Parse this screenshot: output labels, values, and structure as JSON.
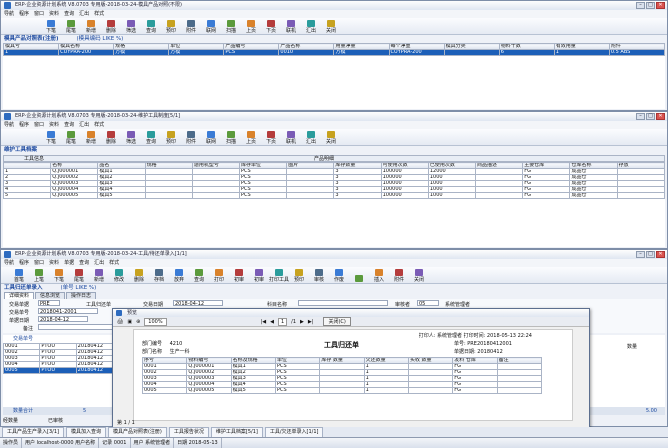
{
  "w1": {
    "title": "ERP-企业资源计划系统 V8.0703 专用版-2018-03-24-模具产品对照(不限)",
    "menus": [
      "导航",
      "程序",
      "窗口",
      "资料",
      "查询",
      "汇出",
      "样式"
    ],
    "tools": [
      "下笔",
      "尾笔",
      "新增",
      "删除",
      "筛选",
      "查询",
      "预印",
      "附件",
      "联网",
      "扫描",
      "上页",
      "下页",
      "联机",
      "汇出",
      "关闭"
    ],
    "sect": "模具产品对照表(注册)",
    "sect_sub": "(模具编码 LIKE %)",
    "cols": [
      "模具号",
      "模具名称",
      "规格",
      "单位",
      "产品编号",
      "产品名称",
      "用量净量",
      "每个净重",
      "模具分类",
      "物料十数",
      "有效用量",
      "附件"
    ],
    "row": [
      "1",
      "CUYPRA-200",
      "方模",
      "方模",
      "PCS",
      "0010",
      "方模",
      "CUYPRA-200",
      "",
      "6",
      "1",
      "0.5 ABS"
    ]
  },
  "w2": {
    "title": "ERP-企业资源计划系统 V8.0703 专用版-2018-03-24-维护工具制度[5/1]",
    "menus": [
      "导航",
      "程序",
      "窗口",
      "资料",
      "查询",
      "汇出",
      "样式"
    ],
    "tools": [
      "下笔",
      "尾笔",
      "新增",
      "删除",
      "筛选",
      "查询",
      "预印",
      "附件",
      "联网",
      "扫描",
      "上页",
      "下页",
      "联机",
      "汇出",
      "关闭"
    ],
    "sect": "维护工具档案",
    "group": "工具信息",
    "group2": "产品明细",
    "cols": [
      "",
      "名称",
      "品名",
      "规格",
      "适用机型号",
      "库存单位",
      "图片",
      "库存数量",
      "可使用次数",
      "已使用次数",
      "商品描述",
      "主要仓库",
      "仓库名称",
      "存放"
    ],
    "rows": [
      [
        "1",
        "Q.J000001",
        "模具1",
        "",
        "",
        "PCS",
        "",
        "3",
        "100000",
        "12000",
        "",
        "FG",
        "成品仓",
        ""
      ],
      [
        "2",
        "Q.J000002",
        "模具2",
        "",
        "",
        "PCS",
        "",
        "3",
        "100000",
        "1000",
        "",
        "FG",
        "成品仓",
        ""
      ],
      [
        "3",
        "Q.J000003",
        "模具3",
        "",
        "",
        "PCS",
        "",
        "3",
        "100000",
        "1000",
        "",
        "FG",
        "成品仓",
        ""
      ],
      [
        "4",
        "Q.J000004",
        "模具4",
        "",
        "",
        "PCS",
        "",
        "3",
        "100000",
        "1000",
        "",
        "FG",
        "成品仓",
        ""
      ],
      [
        "5",
        "Q.J000005",
        "模具5",
        "",
        "",
        "PCS",
        "",
        "3",
        "100000",
        "1000",
        "",
        "FG",
        "成品仓",
        ""
      ]
    ]
  },
  "w3": {
    "title": "ERP-企业资源计划系统 V8.0703 专用版-2018-03-24-工具/待还单录入[1/1]",
    "menus": [
      "导航",
      "程序",
      "窗口",
      "资料",
      "单据",
      "查询",
      "汇出",
      "样式"
    ],
    "tools": [
      "首笔",
      "上笔",
      "下笔",
      "尾笔",
      "新增",
      "修改",
      "删除",
      "存档",
      "放弃",
      "查询",
      "打印",
      "初审",
      "初审",
      "打印工具",
      "预印",
      "审核",
      "作废",
      "",
      "插入",
      "附件",
      "关闭"
    ],
    "sect": "工具归还单录入",
    "sect_sub": "(单号 LIKE %)",
    "tabs": [
      "详细资料",
      "信息浏览",
      "操作日志"
    ],
    "form": {
      "type_label": "交易单据",
      "type": "PRE",
      "tool_label": "工具归还单",
      "date_label": "交易日期",
      "date": "2018-04-12",
      "dept_label": "科目名称",
      "auditor_label": "审核者",
      "auditor": "05",
      "auditor_name": "系统管理者",
      "no_label": "交易单号",
      "no": "2018041-2001",
      "date2_label": "单据日期",
      "date2": "2018-04-12",
      "remark_label": "备注"
    },
    "list_label": "交易单号",
    "list": [
      [
        "0001",
        "PTOU",
        "20180412"
      ],
      [
        "0002",
        "PTOU",
        "20180412"
      ],
      [
        "0003",
        "PTOU",
        "20180412"
      ],
      [
        "0004",
        "PTOU",
        "20180412"
      ],
      [
        "0005",
        "PTOU",
        "20180412"
      ]
    ],
    "footer_label": "数量合计",
    "right_label": "数量",
    "right_val": "5.00",
    "footer_total": "5",
    "bottom_labels": [
      "经数量",
      "已审核"
    ]
  },
  "preview": {
    "title": "预览",
    "zoom": "100%",
    "page": "1",
    "of": "/1",
    "close": "关闭(C)",
    "print_info": "打印时间: 2018-05-13 22:24",
    "print_user": "打印人: 系统管理者",
    "doc_title": "工具归还单",
    "dept_label": "部门编号",
    "dept": "4210",
    "dept_name_label": "部门名称",
    "dept_name": "生产一科",
    "no_label": "单号",
    "no": "PRE20180412001",
    "date_label": "单据日期",
    "date": "20180412",
    "cols": [
      "序号",
      "物料编号",
      "名称及规格",
      "单位",
      "库存\n数量",
      "欠还数量",
      "实收\n数量",
      "发料\n仓库",
      "备注"
    ],
    "rows": [
      [
        "0001",
        "Q.J000001",
        "模具1",
        "PCS",
        "",
        "1",
        "",
        "FG",
        ""
      ],
      [
        "0002",
        "Q.J000002",
        "模具2",
        "PCS",
        "",
        "1",
        "",
        "FG",
        ""
      ],
      [
        "0003",
        "Q.J000003",
        "模具3",
        "PCS",
        "",
        "1",
        "",
        "FG",
        ""
      ],
      [
        "0004",
        "Q.J000004",
        "模具4",
        "PCS",
        "",
        "1",
        "",
        "FG",
        ""
      ],
      [
        "0005",
        "Q.J000005",
        "模具5",
        "PCS",
        "",
        "1",
        "",
        "FG",
        ""
      ]
    ],
    "pageinfo": "第 1 / 1"
  },
  "tabs": [
    "工具产品生产录入[3/1]",
    "模具加入查询",
    "模具产品对照表(注册)",
    "工具报告状况",
    "维护工具档案[5/1]",
    "工具/欠还单录入[1/1]"
  ],
  "status": [
    "操作员",
    "用户 localhost-0000 用户名称",
    "记录 0001",
    "用户 系统管理者",
    "日期 2018-05-13"
  ]
}
